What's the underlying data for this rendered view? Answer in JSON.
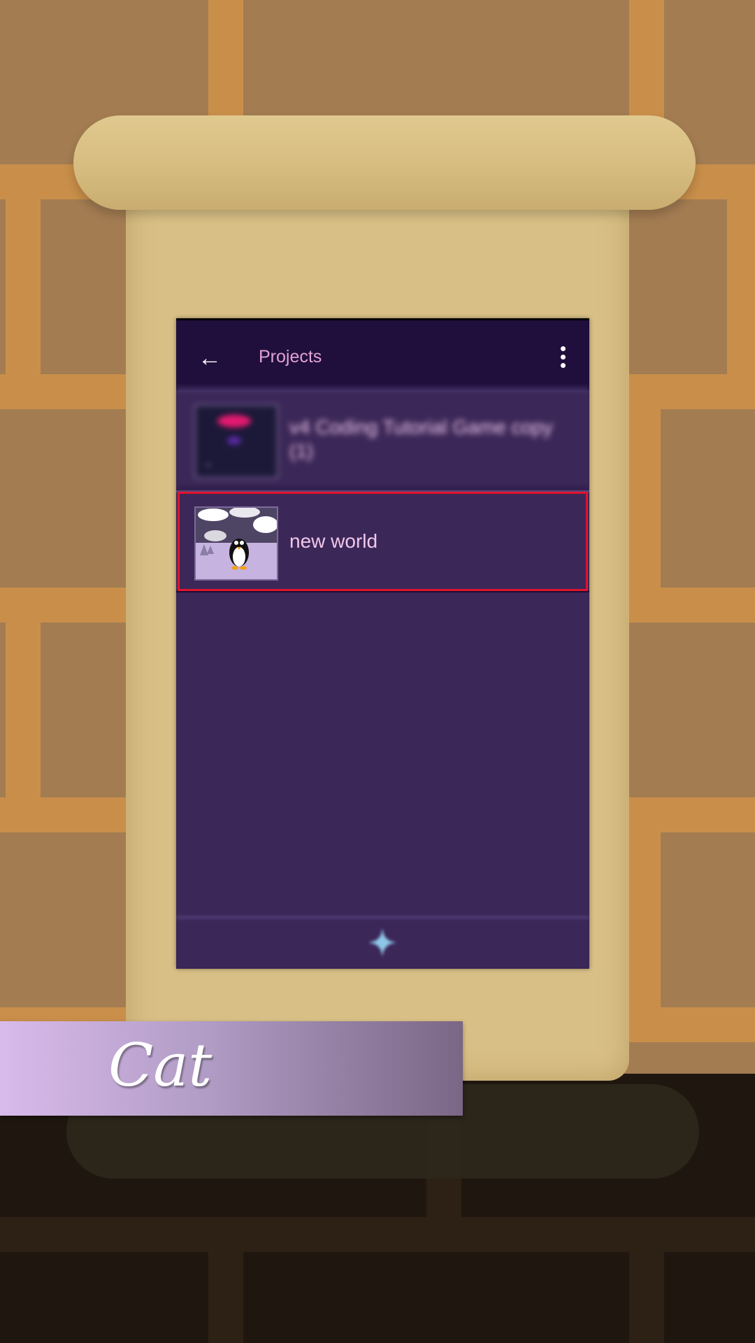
{
  "appbar": {
    "title": "Projects",
    "back_icon": "arrow-left-icon",
    "menu_icon": "more-vert-icon"
  },
  "projects": [
    {
      "name": "v4 Coding Tutorial Game copy (1)",
      "blurred": true
    },
    {
      "name": "new world",
      "selected": true
    }
  ],
  "bottom": {
    "add_symbol": "✦",
    "add_icon": "add-icon"
  },
  "banner": {
    "text": "Cat"
  },
  "colors": {
    "appbar": "#200f3d",
    "panel": "#3b2758",
    "title": "#e2a3d2",
    "selection": "#e0142d",
    "add": "#8ec7e8"
  }
}
